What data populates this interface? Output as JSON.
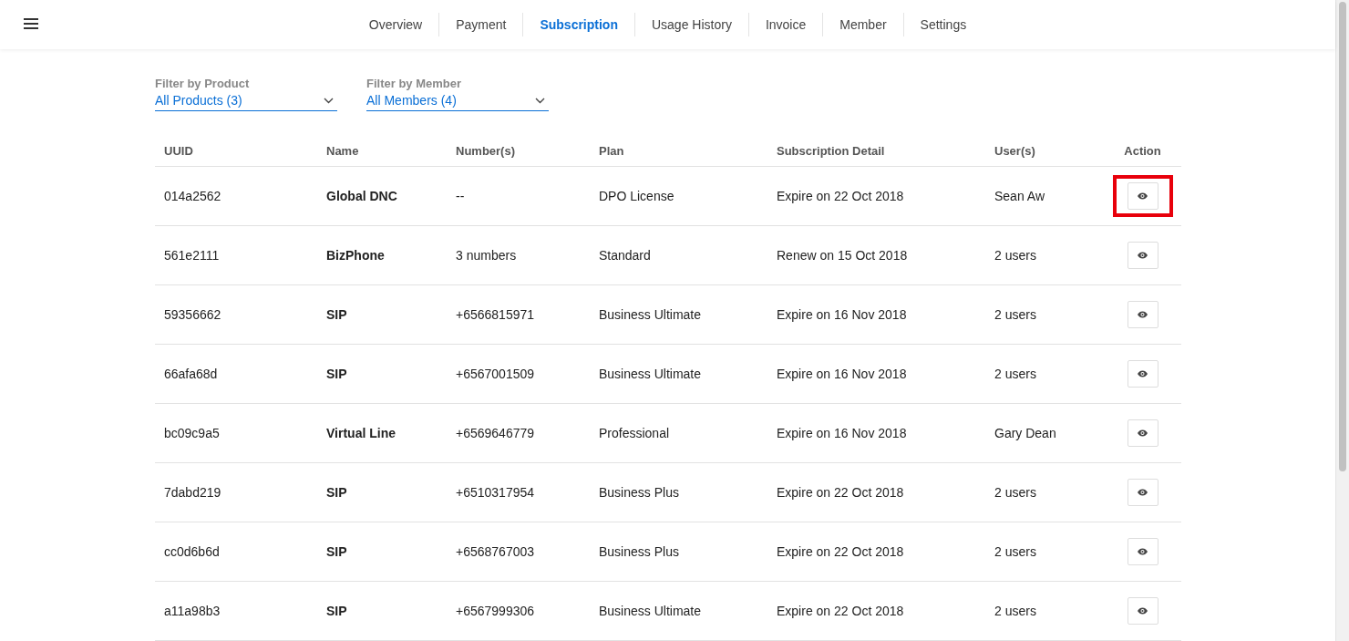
{
  "nav": {
    "tabs": [
      {
        "label": "Overview",
        "selected": false
      },
      {
        "label": "Payment",
        "selected": false
      },
      {
        "label": "Subscription",
        "selected": true
      },
      {
        "label": "Usage History",
        "selected": false
      },
      {
        "label": "Invoice",
        "selected": false
      },
      {
        "label": "Member",
        "selected": false
      },
      {
        "label": "Settings",
        "selected": false
      }
    ]
  },
  "filters": [
    {
      "label": "Filter by Product",
      "value": "All Products (3)"
    },
    {
      "label": "Filter by Member",
      "value": "All Members (4)"
    }
  ],
  "table": {
    "columns": [
      "UUID",
      "Name",
      "Number(s)",
      "Plan",
      "Subscription Detail",
      "User(s)",
      "Action"
    ],
    "rows": [
      {
        "uuid": "014a2562",
        "name": "Global DNC",
        "numbers": "--",
        "plan": "DPO License",
        "detail": "Expire on 22 Oct 2018",
        "users": "Sean Aw",
        "highlighted": true
      },
      {
        "uuid": "561e2111",
        "name": "BizPhone",
        "numbers": "3 numbers",
        "plan": "Standard",
        "detail": "Renew on 15 Oct 2018",
        "users": "2 users",
        "highlighted": false
      },
      {
        "uuid": "59356662",
        "name": "SIP",
        "numbers": "+6566815971",
        "plan": "Business Ultimate",
        "detail": "Expire on 16 Nov 2018",
        "users": "2 users",
        "highlighted": false
      },
      {
        "uuid": "66afa68d",
        "name": "SIP",
        "numbers": "+6567001509",
        "plan": "Business Ultimate",
        "detail": "Expire on 16 Nov 2018",
        "users": "2 users",
        "highlighted": false
      },
      {
        "uuid": "bc09c9a5",
        "name": "Virtual Line",
        "numbers": "+6569646779",
        "plan": "Professional",
        "detail": "Expire on 16 Nov 2018",
        "users": "Gary Dean",
        "highlighted": false
      },
      {
        "uuid": "7dabd219",
        "name": "SIP",
        "numbers": "+6510317954",
        "plan": "Business Plus",
        "detail": "Expire on 22 Oct 2018",
        "users": "2 users",
        "highlighted": false
      },
      {
        "uuid": "cc0d6b6d",
        "name": "SIP",
        "numbers": "+6568767003",
        "plan": "Business Plus",
        "detail": "Expire on 22 Oct 2018",
        "users": "2 users",
        "highlighted": false
      },
      {
        "uuid": "a11a98b3",
        "name": "SIP",
        "numbers": "+6567999306",
        "plan": "Business Ultimate",
        "detail": "Expire on 22 Oct 2018",
        "users": "2 users",
        "highlighted": false
      }
    ]
  }
}
